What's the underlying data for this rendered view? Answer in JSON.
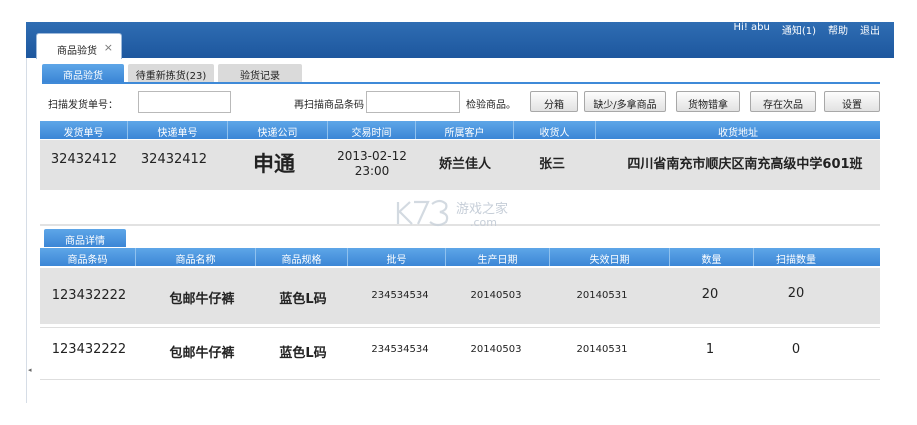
{
  "header": {
    "greeting": "Hi! abu",
    "notify": "通知(1)",
    "help": "帮助",
    "logout": "退出"
  },
  "window_tab": {
    "label": "商品验货",
    "close": "×"
  },
  "subtabs": [
    "商品验货",
    "待重新拣货(23)",
    "验货记录"
  ],
  "toolbar": {
    "scan_order_label": "扫描发货单号：",
    "scan_order_value": "",
    "rescan_label": "再扫描商品条码",
    "rescan_value": "",
    "check_label": "检验商品。",
    "buttons": [
      "分箱",
      "缺少/多拿商品",
      "货物错拿",
      "存在次品",
      "设置"
    ]
  },
  "order_table": {
    "headers": [
      "发货单号",
      "快递单号",
      "快递公司",
      "交易时间",
      "所属客户",
      "收货人",
      "收货地址"
    ],
    "row": {
      "ship_no": "32432412",
      "express_no": "32432412",
      "company": "申通",
      "time_date": "2013-02-12",
      "time_clock": "23:00",
      "customer": "娇兰佳人",
      "receiver": "张三",
      "address": "四川省南充市顺庆区南充高级中学601班"
    }
  },
  "detail_tab": "商品详情",
  "detail_table": {
    "headers": [
      "商品条码",
      "商品名称",
      "商品规格",
      "批号",
      "生产日期",
      "失效日期",
      "数量",
      "扫描数量"
    ],
    "rows": [
      {
        "barcode": "123432222",
        "name": "包邮牛仔裤",
        "spec": "蓝色L码",
        "batch": "234534534",
        "prod": "20140503",
        "expire": "20140531",
        "qty": "20",
        "scanned": "20"
      },
      {
        "barcode": "123432222",
        "name": "包邮牛仔裤",
        "spec": "蓝色L码",
        "batch": "234534534",
        "prod": "20140503",
        "expire": "20140531",
        "qty": "1",
        "scanned": "0"
      }
    ]
  },
  "watermark": {
    "text": "游戏之家",
    "sub": ".com"
  },
  "gutter_arrow": "◂",
  "colors": {
    "header_blue": "#1d579e",
    "tab_blue": "#3b86d6",
    "row_gray": "#e3e3e3"
  }
}
